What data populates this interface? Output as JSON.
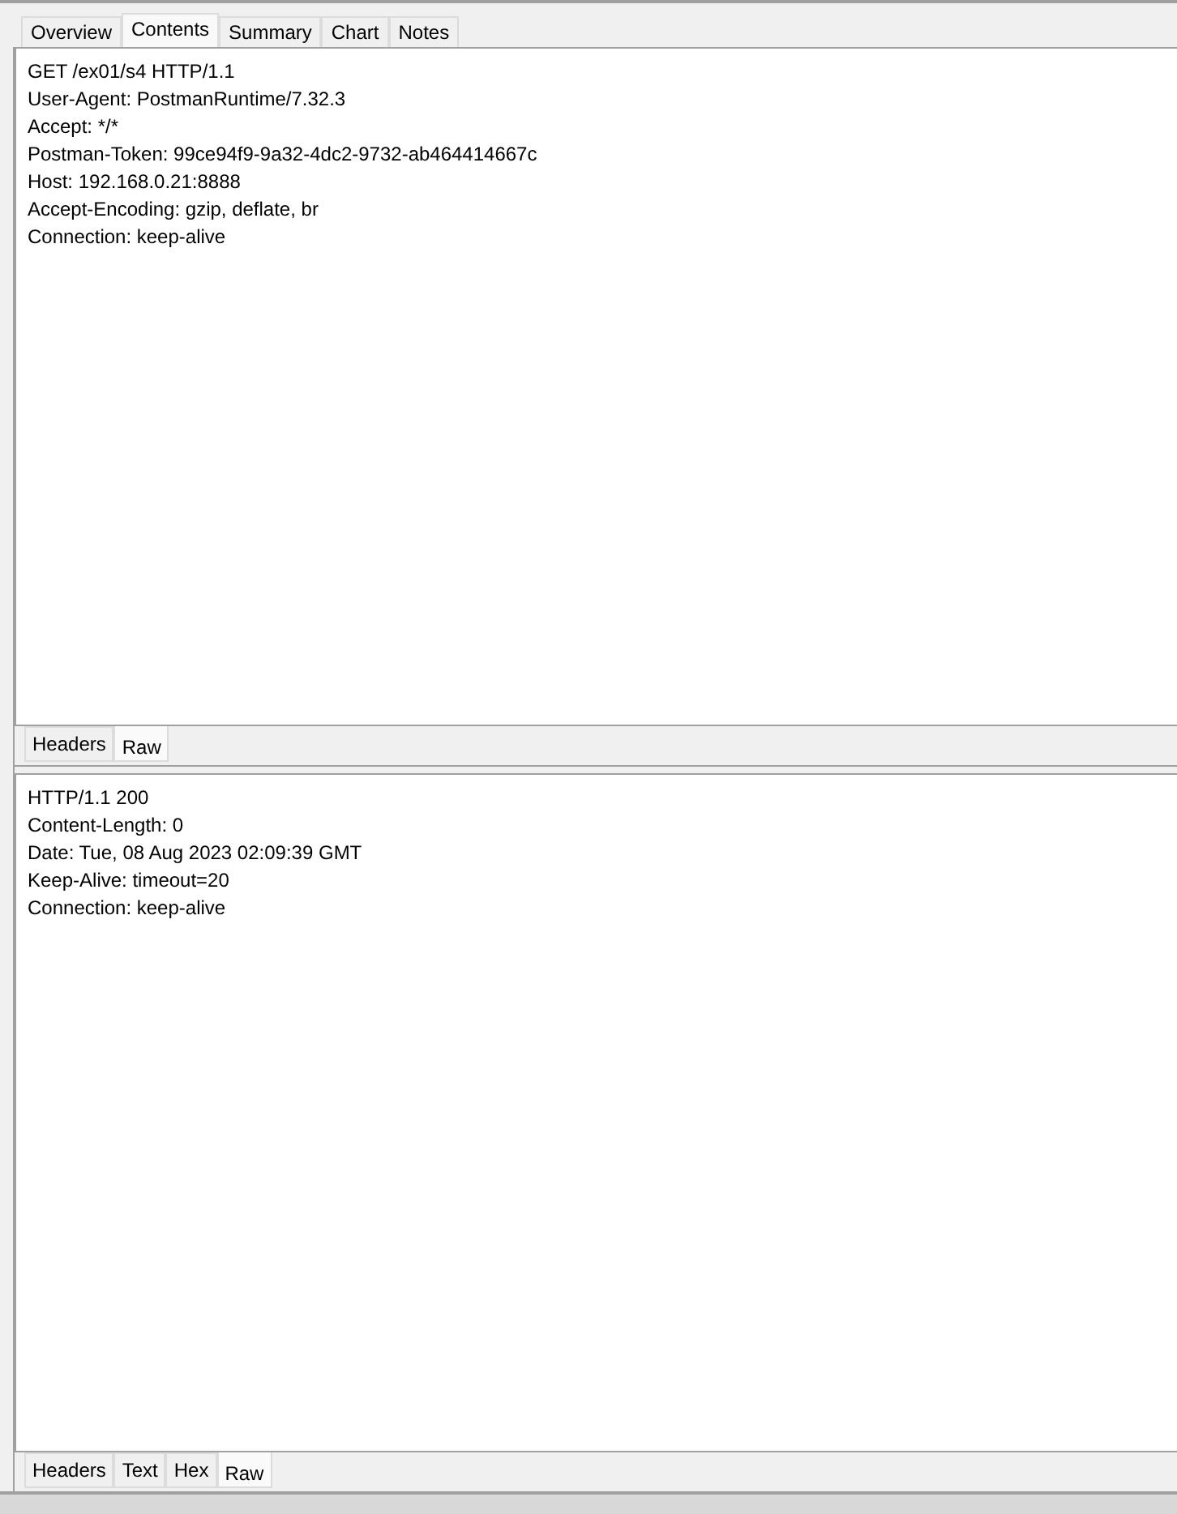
{
  "tabs": [
    {
      "label": "Overview",
      "selected": false
    },
    {
      "label": "Contents",
      "selected": true
    },
    {
      "label": "Summary",
      "selected": false
    },
    {
      "label": "Chart",
      "selected": false
    },
    {
      "label": "Notes",
      "selected": false
    }
  ],
  "request": {
    "lines": [
      "GET /ex01/s4 HTTP/1.1",
      "User-Agent: PostmanRuntime/7.32.3",
      "Accept: */*",
      "Postman-Token: 99ce94f9-9a32-4dc2-9732-ab464414667c",
      "Host: 192.168.0.21:8888",
      "Accept-Encoding: gzip, deflate, br",
      "Connection: keep-alive"
    ],
    "tabs": [
      {
        "label": "Headers",
        "selected": false
      },
      {
        "label": "Raw",
        "selected": true
      }
    ]
  },
  "response": {
    "lines": [
      "HTTP/1.1 200",
      "Content-Length: 0",
      "Date: Tue, 08 Aug 2023 02:09:39 GMT",
      "Keep-Alive: timeout=20",
      "Connection: keep-alive"
    ],
    "tabs": [
      {
        "label": "Headers",
        "selected": false
      },
      {
        "label": "Text",
        "selected": false
      },
      {
        "label": "Hex",
        "selected": false
      },
      {
        "label": "Raw",
        "selected": true
      }
    ]
  }
}
